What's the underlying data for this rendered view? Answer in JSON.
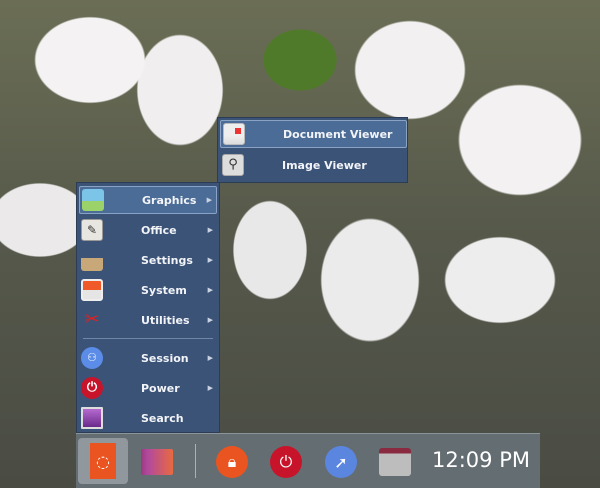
{
  "menu": {
    "items": [
      {
        "label": "Graphics",
        "icon": "graphics-icon",
        "submenu": true
      },
      {
        "label": "Office",
        "icon": "office-icon",
        "submenu": true
      },
      {
        "label": "Settings",
        "icon": "settings-icon",
        "submenu": true
      },
      {
        "label": "System",
        "icon": "system-icon",
        "submenu": true
      },
      {
        "label": "Utilities",
        "icon": "utilities-icon",
        "submenu": true
      },
      {
        "label": "Session",
        "icon": "session-icon",
        "submenu": true
      },
      {
        "label": "Power",
        "icon": "power-icon",
        "submenu": true
      },
      {
        "label": "Search",
        "icon": "search-icon",
        "submenu": false
      }
    ],
    "arrow": "▶"
  },
  "submenu": {
    "items": [
      {
        "label": "Document Viewer",
        "icon": "document-viewer-icon"
      },
      {
        "label": "Image Viewer",
        "icon": "image-viewer-icon"
      }
    ]
  },
  "panel": {
    "clock": "12:09 PM",
    "launchers": [
      "ubuntu-menu",
      "workspace",
      "lock-screen",
      "shutdown",
      "web-browser",
      "file-manager"
    ]
  },
  "colors": {
    "menu_bg": "#3c5378",
    "highlight": "#4c6c98",
    "ubuntu_orange": "#e95420"
  }
}
